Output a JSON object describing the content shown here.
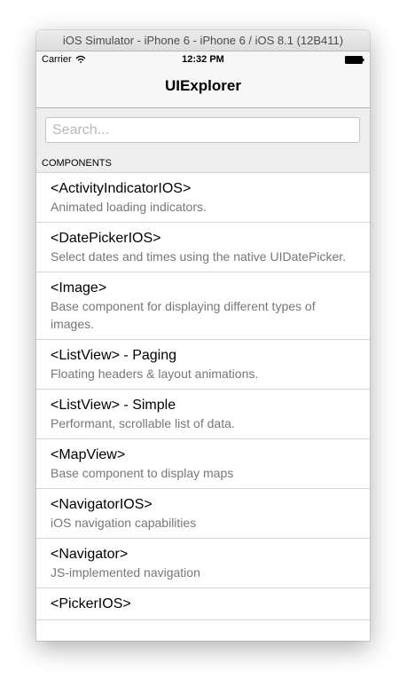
{
  "window": {
    "title": "iOS Simulator - iPhone 6 - iPhone 6 / iOS 8.1 (12B411)"
  },
  "status_bar": {
    "carrier": "Carrier",
    "time": "12:32 PM"
  },
  "nav_bar": {
    "title": "UIExplorer"
  },
  "search": {
    "placeholder": "Search...",
    "value": ""
  },
  "section": {
    "header": "COMPONENTS"
  },
  "items": [
    {
      "title": "<ActivityIndicatorIOS>",
      "description": "Animated loading indicators."
    },
    {
      "title": "<DatePickerIOS>",
      "description": "Select dates and times using the native UIDatePicker."
    },
    {
      "title": "<Image>",
      "description": "Base component for displaying different types of images."
    },
    {
      "title": "<ListView> - Paging",
      "description": "Floating headers & layout animations."
    },
    {
      "title": "<ListView> - Simple",
      "description": "Performant, scrollable list of data."
    },
    {
      "title": "<MapView>",
      "description": "Base component to display maps"
    },
    {
      "title": "<NavigatorIOS>",
      "description": "iOS navigation capabilities"
    },
    {
      "title": "<Navigator>",
      "description": "JS-implemented navigation"
    },
    {
      "title": "<PickerIOS>",
      "description": ""
    }
  ]
}
